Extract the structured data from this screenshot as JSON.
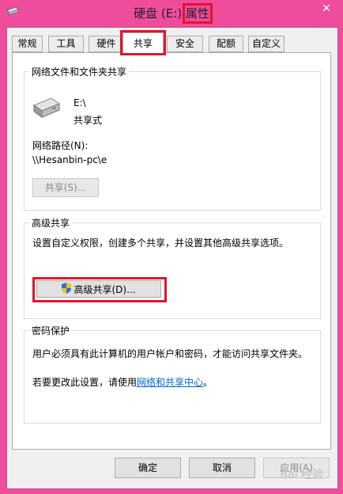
{
  "window": {
    "title_prefix": "硬盘 (E:)",
    "title_highlight": "属性",
    "close_symbol": "✕"
  },
  "tabs": [
    {
      "label": "常规"
    },
    {
      "label": "工具"
    },
    {
      "label": "硬件"
    },
    {
      "label": "共享"
    },
    {
      "label": "安全"
    },
    {
      "label": "配额"
    },
    {
      "label": "自定义"
    }
  ],
  "network_share": {
    "group_title": "网络文件和文件夹共享",
    "drive_name": "E:\\",
    "share_status": "共享式",
    "path_label": "网络路径(N):",
    "path_value": "\\\\Hesanbin-pc\\e",
    "share_button": "共享(S)..."
  },
  "advanced_share": {
    "group_title": "高级共享",
    "description": "设置自定义权限，创建多个共享，并设置其他高级共享选项。",
    "button": "高级共享(D)..."
  },
  "password": {
    "group_title": "密码保护",
    "description": "用户必须具有此计算机的用户帐户和密码，才能访问共享文件夹。",
    "change_prefix": "若要更改此设置，请使用",
    "link": "网络和共享中心",
    "change_suffix": "。"
  },
  "footer": {
    "ok": "确定",
    "cancel": "取消",
    "apply": "应用(A)"
  },
  "watermark": "Bai 经验"
}
